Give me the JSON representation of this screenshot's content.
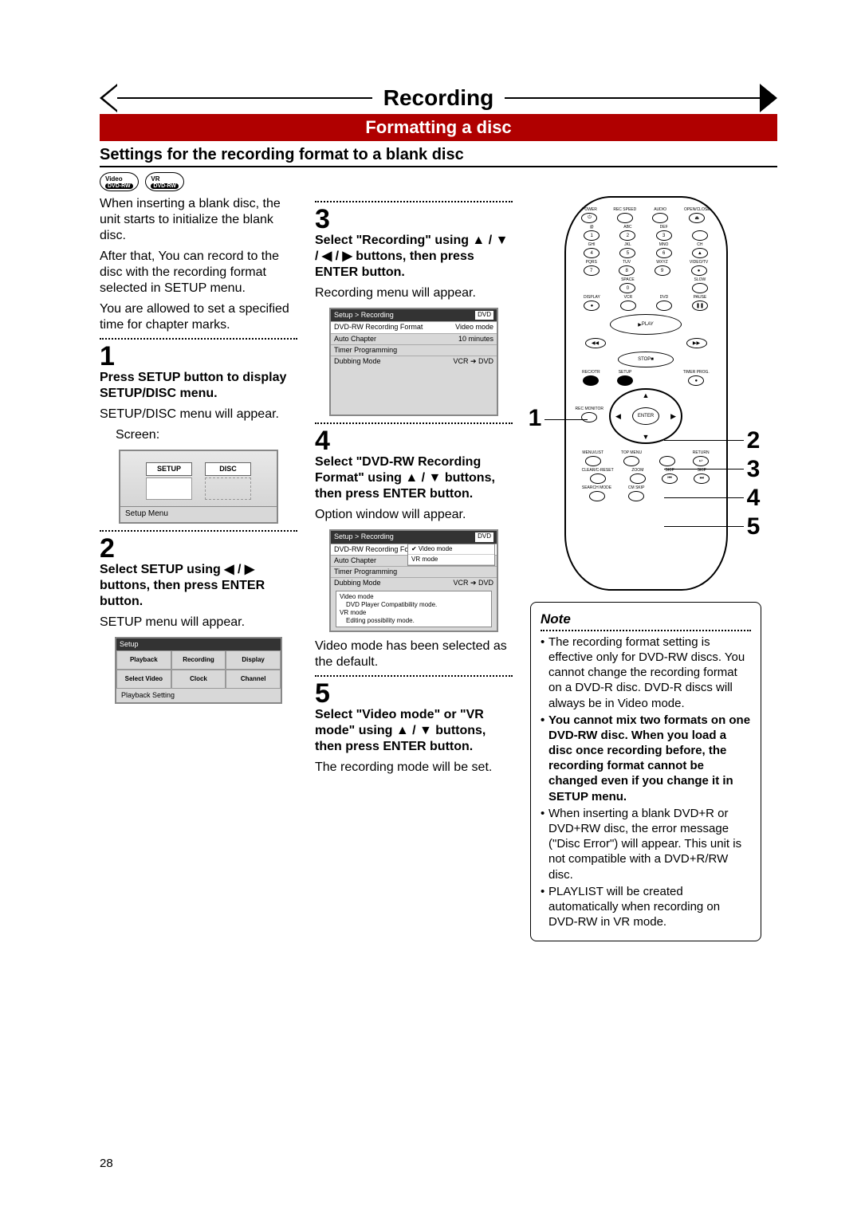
{
  "header": {
    "title": "Recording",
    "redbar": "Formatting a disc",
    "subhead": "Settings for the recording format to a blank disc"
  },
  "badges": [
    {
      "top": "Video",
      "bot": "DVD-RW"
    },
    {
      "top": "VR",
      "bot": "DVD-RW"
    }
  ],
  "col1": {
    "intro1": "When inserting a blank disc, the unit starts to initialize the blank disc.",
    "intro2": "After that, You can record to the disc with the recording format selected in SETUP menu.",
    "intro3": "You are allowed to set a specified time for chapter marks.",
    "step1num": "1",
    "step1bold": "Press SETUP button to display SETUP/DISC menu.",
    "step1line": "SETUP/DISC menu will appear.",
    "step1screen": "Screen:",
    "setupdisc_setup": "SETUP",
    "setupdisc_disc": "DISC",
    "setupdisc_caption": "Setup Menu",
    "step2num": "2",
    "step2bold": "Select SETUP using ◀ / ▶ buttons, then press ENTER button.",
    "step2line": "SETUP menu will appear.",
    "menu_hdr": "Setup",
    "menu_cells": [
      "Playback",
      "Recording",
      "Display",
      "Select Video",
      "Clock",
      "Channel"
    ],
    "menu_caption": "Playback Setting"
  },
  "col2": {
    "step3num": "3",
    "step3bold": "Select \"Recording\" using ▲ / ▼ / ◀ / ▶ buttons, then press ENTER button.",
    "step3line": "Recording menu will appear.",
    "rec_breadcrumb": "Setup > Recording",
    "rec_badge": "DVD",
    "rec_rows": [
      {
        "l": "DVD-RW Recording Format",
        "r": "Video mode"
      },
      {
        "l": "Auto Chapter",
        "r": "10 minutes"
      },
      {
        "l": "Timer Programming",
        "r": ""
      },
      {
        "l": "Dubbing Mode",
        "r": "VCR ➔ DVD"
      }
    ],
    "step4num": "4",
    "step4bold": "Select \"DVD-RW Recording Format\" using ▲ / ▼ buttons, then press ENTER button.",
    "step4line": "Option window will appear.",
    "opt_rows": [
      {
        "l": "DVD-RW Recording Form",
        "r": "✔ Video mode"
      },
      {
        "l": "Auto Chapter",
        "r": "VR mode"
      },
      {
        "l": "Timer Programming",
        "r": ""
      },
      {
        "l": "Dubbing Mode",
        "r": "VCR ➔ DVD"
      }
    ],
    "vdesc1": "Video mode",
    "vdesc2": "DVD Player Compatibility mode.",
    "vdesc3": "VR mode",
    "vdesc4": "Editing possibility mode.",
    "step4after": "Video mode has been selected as the default.",
    "step5num": "5",
    "step5bold": "Select \"Video mode\" or \"VR mode\" using ▲ / ▼ buttons, then press ENTER button.",
    "step5line": "The recording mode will be set."
  },
  "remote": {
    "row1": [
      "POWER",
      "REC SPEED",
      "AUDIO",
      "OPEN/CLOSE"
    ],
    "row2lab": [
      "@",
      "ABC",
      "DEF"
    ],
    "row2": [
      "1",
      "2",
      "3"
    ],
    "row3lab": [
      "GHI",
      "JKL",
      "MNO",
      "CH"
    ],
    "row3": [
      "4",
      "5",
      "6",
      "▲"
    ],
    "row4lab": [
      "PQRS",
      "TUV",
      "WXYZ",
      "VIDEO/TV"
    ],
    "row4": [
      "7",
      "8",
      "9"
    ],
    "row5lab": [
      "",
      "SPACE",
      "",
      "SLOW"
    ],
    "row5": [
      "",
      "0",
      "",
      ""
    ],
    "row6lab": [
      "DISPLAY",
      "VCR",
      "DVD",
      "PAUSE"
    ],
    "playlabel": "PLAY",
    "stoplabel": "STOP",
    "rew": "◀◀",
    "ffw": "▶▶",
    "row7lab": [
      "REC/OTR",
      "SETUP",
      "",
      "TIMER PROG."
    ],
    "row8lab": [
      "REC MONITOR",
      "",
      "ENTER",
      ""
    ],
    "row9lab": [
      "MENU/LIST",
      "TOP MENU",
      "",
      "RETURN"
    ],
    "row10lab": [
      "CLEAR/C-RESET",
      "ZOOM",
      "SKIP",
      "SKIP"
    ],
    "row11lab": [
      "SEARCH MODE",
      "CM SKIP",
      "",
      ""
    ],
    "callouts": [
      "1",
      "2",
      "3",
      "4",
      "5"
    ]
  },
  "note": {
    "title": "Note",
    "items": [
      "The recording format setting is effective only for DVD-RW discs. You cannot change the recording format on a DVD-R disc. DVD-R discs will always be in Video mode.",
      "You cannot mix two formats on one DVD-RW disc. When you load a disc once recording before, the recording format cannot be changed even if you change it in SETUP menu.",
      "When inserting a blank DVD+R or DVD+RW disc, the error message (\"Disc Error\") will appear. This unit is not compatible with a DVD+R/RW disc.",
      "PLAYLIST will be created automatically when recording on DVD-RW in VR mode."
    ],
    "bold_item_index": 1
  },
  "page": "28"
}
